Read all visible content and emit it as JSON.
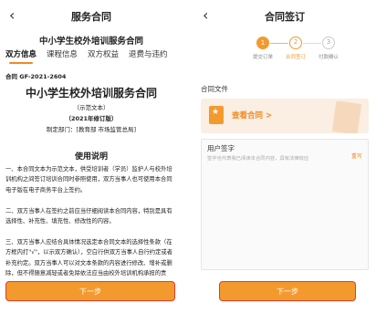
{
  "left": {
    "nav_title": "服务合同",
    "back_glyph": "‹",
    "subtitle": "中小学生校外培训服务合同",
    "tabs": [
      "双方信息",
      "课程信息",
      "双方权益",
      "退费与违约"
    ],
    "contract_no": "合同 GF-2021-2604",
    "doc_title": "中小学生校外培训服务合同",
    "doc_lines": [
      "（示范文本）",
      "（2021年修订版）",
      "制定部门：[教育部 市场监管总局]"
    ],
    "instructions_title": "使用说明",
    "paragraphs": [
      "一、本合同文本为示范文本，供受培训者（学员）监护人与校外培训机构之间签订培训合同时参照使用，双方当事人也可使用本合同电子版在电子商务平台上签约。",
      "二、双方当事人在签约之前应当仔细阅读本合同内容，特别是具有选择性、补充性、填充性、修改性的内容。",
      "三、双方当事人应结合具体情况选定本合同文本的选择性条款（在方框内打\"√\"，以示双方确认），空白行供双方当事人自行约定或者补充约定。双方当事人可以对文本条款的内容进行修改、增补或删除，但不得随意减轻或者免除依法应当由校外培训机构承担的责"
    ],
    "next_button": "下一步"
  },
  "right": {
    "nav_title": "合同签订",
    "back_glyph": "‹",
    "steps": [
      {
        "num": "1",
        "label": "提交订单"
      },
      {
        "num": "2",
        "label": "合同签订"
      },
      {
        "num": "3",
        "label": "付款确认"
      }
    ],
    "file_section": "合同文件",
    "file_link": "查看合同 >",
    "signature": {
      "title": "用户签字",
      "hint": "签字也代表我已阅读本合同内容，具有法律效应",
      "rewrite": "重写"
    },
    "next_button": "下一步"
  },
  "colors": {
    "accent": "#f39a2e",
    "highlight_border": "#e23b2e"
  }
}
